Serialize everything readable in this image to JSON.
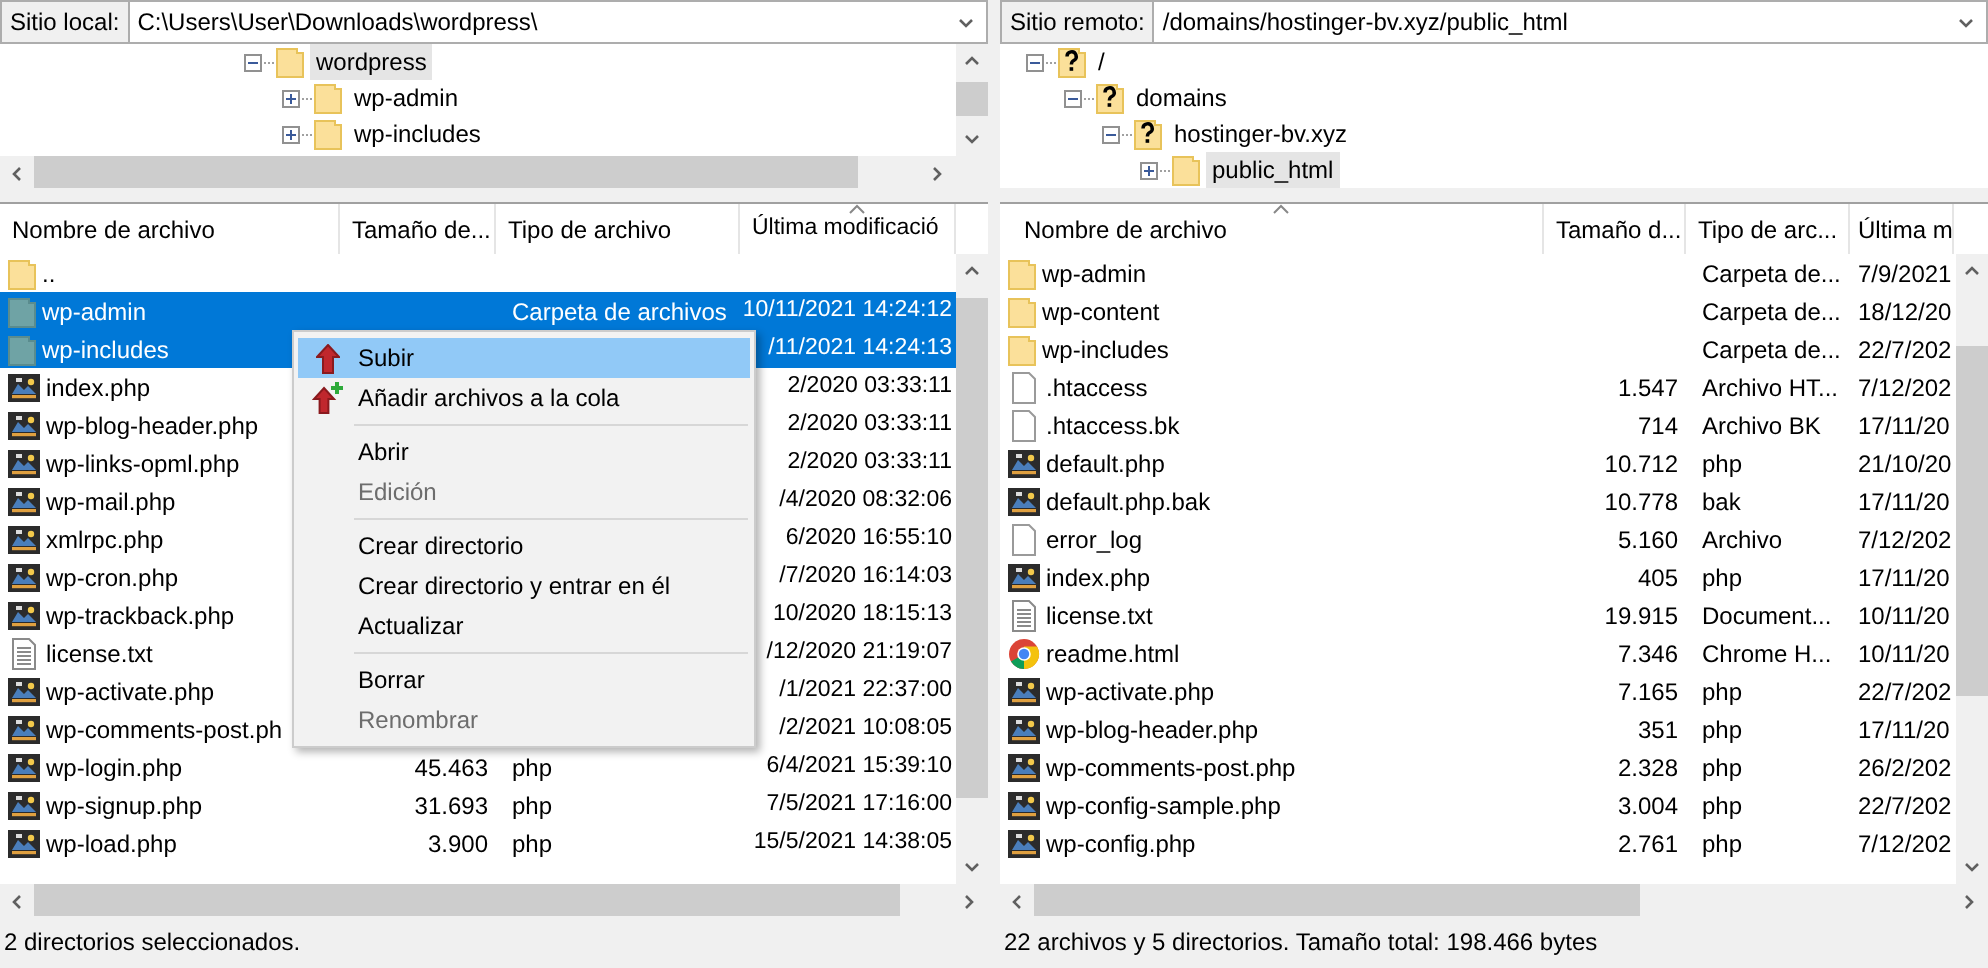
{
  "local_site": {
    "label": "Sitio local:",
    "path": "C:\\Users\\User\\Downloads\\wordpress\\",
    "tree": [
      {
        "label": "wordpress",
        "kind": "folder",
        "expanded": true,
        "selected": true,
        "children": [
          {
            "label": "wp-admin",
            "kind": "folder",
            "expanded": false,
            "selected": false
          },
          {
            "label": "wp-includes",
            "kind": "folder",
            "expanded": false,
            "selected": false
          }
        ]
      }
    ],
    "columns": [
      {
        "label": "Nombre de archivo",
        "sorted": false
      },
      {
        "label": "Tamaño de...",
        "sorted": false
      },
      {
        "label": "Tipo de archivo",
        "sorted": false
      },
      {
        "label": "Última modificació",
        "sorted": true
      }
    ],
    "rows": [
      {
        "name": "..",
        "kind": "folder",
        "selected": false
      },
      {
        "name": "wp-admin",
        "kind": "folder",
        "type": "Carpeta de archivos",
        "date": "10/11/2021 14:24:12",
        "selected": true
      },
      {
        "name": "wp-includes",
        "kind": "folder",
        "date": "/11/2021 14:24:13",
        "selected": true
      },
      {
        "name": "index.php",
        "kind": "php",
        "date": "2/2020 03:33:11",
        "selected": false
      },
      {
        "name": "wp-blog-header.php",
        "kind": "php",
        "date": "2/2020 03:33:11",
        "selected": false
      },
      {
        "name": "wp-links-opml.php",
        "kind": "php",
        "date": "2/2020 03:33:11",
        "selected": false
      },
      {
        "name": "wp-mail.php",
        "kind": "php",
        "date": "/4/2020 08:32:06",
        "selected": false
      },
      {
        "name": "xmlrpc.php",
        "kind": "php",
        "date": "6/2020 16:55:10",
        "selected": false
      },
      {
        "name": "wp-cron.php",
        "kind": "php",
        "date": "/7/2020 16:14:03",
        "selected": false
      },
      {
        "name": "wp-trackback.php",
        "kind": "php",
        "date": "10/2020 18:15:13",
        "selected": false
      },
      {
        "name": "license.txt",
        "kind": "text",
        "date": "/12/2020 21:19:07",
        "selected": false
      },
      {
        "name": "wp-activate.php",
        "kind": "php",
        "date": "/1/2021 22:37:00",
        "selected": false
      },
      {
        "name": "wp-comments-post.ph",
        "kind": "php",
        "date": "/2/2021 10:08:05",
        "selected": false
      },
      {
        "name": "wp-login.php",
        "kind": "php",
        "size": "45.463",
        "type": "php",
        "date": "6/4/2021 15:39:10",
        "selected": false
      },
      {
        "name": "wp-signup.php",
        "kind": "php",
        "size": "31.693",
        "type": "php",
        "date": "7/5/2021 17:16:00",
        "selected": false
      },
      {
        "name": "wp-load.php",
        "kind": "php",
        "size": "3.900",
        "type": "php",
        "date": "15/5/2021 14:38:05",
        "selected": false
      }
    ],
    "status": "2 directorios seleccionados."
  },
  "remote_site": {
    "label": "Sitio remoto:",
    "path": "/domains/hostinger-bv.xyz/public_html",
    "tree": [
      {
        "label": "/",
        "kind": "unknown-folder",
        "expanded": true,
        "selected": false,
        "children": [
          {
            "label": "domains",
            "kind": "unknown-folder",
            "expanded": true,
            "selected": false,
            "children": [
              {
                "label": "hostinger-bv.xyz",
                "kind": "unknown-folder",
                "expanded": true,
                "selected": false,
                "children": [
                  {
                    "label": "public_html",
                    "kind": "folder",
                    "expanded": false,
                    "selected": true
                  }
                ]
              }
            ]
          }
        ]
      }
    ],
    "columns": [
      {
        "label": "Nombre de archivo",
        "sorted": true
      },
      {
        "label": "Tamaño d...",
        "sorted": false
      },
      {
        "label": "Tipo de arc...",
        "sorted": false
      },
      {
        "label": "Última m",
        "sorted": false
      }
    ],
    "rows": [
      {
        "name": "wp-admin",
        "kind": "folder",
        "type": "Carpeta de...",
        "date": "7/9/2021",
        "selected": false
      },
      {
        "name": "wp-content",
        "kind": "folder",
        "type": "Carpeta de...",
        "date": "18/12/20",
        "selected": false
      },
      {
        "name": "wp-includes",
        "kind": "folder",
        "type": "Carpeta de...",
        "date": "22/7/202",
        "selected": false
      },
      {
        "name": ".htaccess",
        "kind": "blank",
        "size": "1.547",
        "type": "Archivo HT...",
        "date": "7/12/202",
        "selected": false
      },
      {
        "name": ".htaccess.bk",
        "kind": "blank",
        "size": "714",
        "type": "Archivo BK",
        "date": "17/11/20",
        "selected": false
      },
      {
        "name": "default.php",
        "kind": "php",
        "size": "10.712",
        "type": "php",
        "date": "21/10/20",
        "selected": false
      },
      {
        "name": "default.php.bak",
        "kind": "php",
        "size": "10.778",
        "type": "bak",
        "date": "17/11/20",
        "selected": false
      },
      {
        "name": "error_log",
        "kind": "blank",
        "size": "5.160",
        "type": "Archivo",
        "date": "7/12/202",
        "selected": false
      },
      {
        "name": "index.php",
        "kind": "php",
        "size": "405",
        "type": "php",
        "date": "17/11/20",
        "selected": false
      },
      {
        "name": "license.txt",
        "kind": "text",
        "size": "19.915",
        "type": "Document...",
        "date": "10/11/20",
        "selected": false
      },
      {
        "name": "readme.html",
        "kind": "browser",
        "size": "7.346",
        "type": "Chrome H...",
        "date": "10/11/20",
        "selected": false
      },
      {
        "name": "wp-activate.php",
        "kind": "php",
        "size": "7.165",
        "type": "php",
        "date": "22/7/202",
        "selected": false
      },
      {
        "name": "wp-blog-header.php",
        "kind": "php",
        "size": "351",
        "type": "php",
        "date": "17/11/20",
        "selected": false
      },
      {
        "name": "wp-comments-post.php",
        "kind": "php",
        "size": "2.328",
        "type": "php",
        "date": "26/2/202",
        "selected": false
      },
      {
        "name": "wp-config-sample.php",
        "kind": "php",
        "size": "3.004",
        "type": "php",
        "date": "22/7/202",
        "selected": false
      },
      {
        "name": "wp-config.php",
        "kind": "php",
        "size": "2.761",
        "type": "php",
        "date": "7/12/202",
        "selected": false
      }
    ],
    "status": "22 archivos y 5 directorios. Tamaño total: 198.466 bytes"
  },
  "context_menu": [
    {
      "kind": "upload",
      "label": "Subir",
      "disabled": false,
      "selected": true
    },
    {
      "kind": "queue",
      "label": "Añadir archivos a la cola",
      "disabled": false,
      "selected": false
    },
    {
      "kind": "separator"
    },
    {
      "kind": "item",
      "label": "Abrir",
      "disabled": false,
      "selected": false
    },
    {
      "kind": "item",
      "label": "Edición",
      "disabled": true,
      "selected": false
    },
    {
      "kind": "separator"
    },
    {
      "kind": "item",
      "label": "Crear directorio",
      "disabled": false,
      "selected": false
    },
    {
      "kind": "item",
      "label": "Crear directorio y entrar en él",
      "disabled": false,
      "selected": false
    },
    {
      "kind": "item",
      "label": "Actualizar",
      "disabled": false,
      "selected": false
    },
    {
      "kind": "separator"
    },
    {
      "kind": "item",
      "label": "Borrar",
      "disabled": false,
      "selected": false
    },
    {
      "kind": "item",
      "label": "Renombrar",
      "disabled": true,
      "selected": false
    }
  ]
}
